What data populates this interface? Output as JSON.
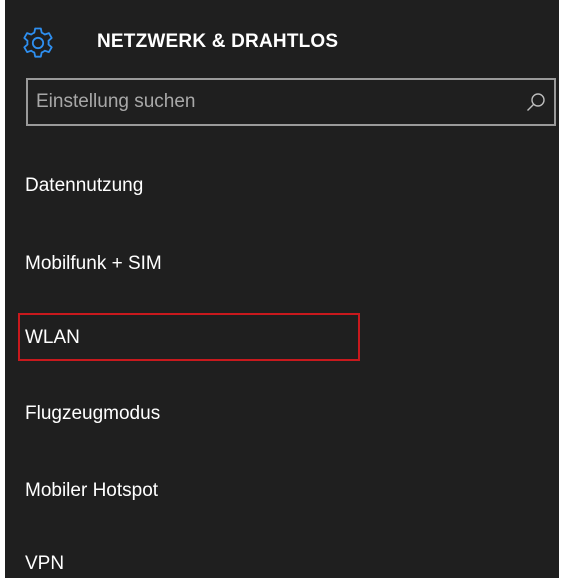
{
  "header": {
    "title": "NETZWERK & DRAHTLOS",
    "icon": "gear-icon",
    "accent_color": "#2e8ff0"
  },
  "search": {
    "placeholder": "Einstellung suchen",
    "value": "",
    "icon": "search-icon"
  },
  "menu": {
    "items": [
      {
        "label": "Datennutzung"
      },
      {
        "label": "Mobilfunk + SIM"
      },
      {
        "label": "WLAN",
        "highlighted": true
      },
      {
        "label": "Flugzeugmodus"
      },
      {
        "label": "Mobiler Hotspot"
      },
      {
        "label": "VPN"
      }
    ]
  },
  "colors": {
    "background": "#1f1f1f",
    "text": "#ffffff",
    "highlight_border": "#c8191d"
  }
}
